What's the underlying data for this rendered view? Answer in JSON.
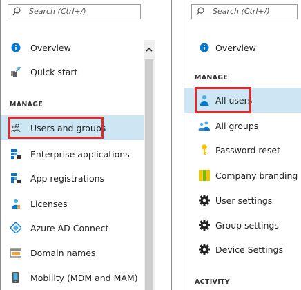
{
  "left_panel": {
    "search_placeholder": "Search (Ctrl+/)",
    "items": [
      {
        "label": "Overview"
      },
      {
        "label": "Quick start"
      },
      {
        "label": "Users and groups"
      },
      {
        "label": "Enterprise applications"
      },
      {
        "label": "App registrations"
      },
      {
        "label": "Licenses"
      },
      {
        "label": "Azure AD Connect"
      },
      {
        "label": "Domain names"
      },
      {
        "label": "Mobility (MDM and MAM)"
      }
    ],
    "section_manage": "MANAGE"
  },
  "right_panel": {
    "search_placeholder": "Search (Ctrl+/)",
    "items": [
      {
        "label": "Overview"
      },
      {
        "label": "All users"
      },
      {
        "label": "All groups"
      },
      {
        "label": "Password reset"
      },
      {
        "label": "Company branding"
      },
      {
        "label": "User settings"
      },
      {
        "label": "Group settings"
      },
      {
        "label": "Device Settings"
      }
    ],
    "section_manage": "MANAGE",
    "section_activity": "ACTIVITY"
  },
  "colors": {
    "selected_bg": "#cce6f4",
    "highlight_border": "#e02b2b",
    "azure_blue": "#0078d4"
  }
}
